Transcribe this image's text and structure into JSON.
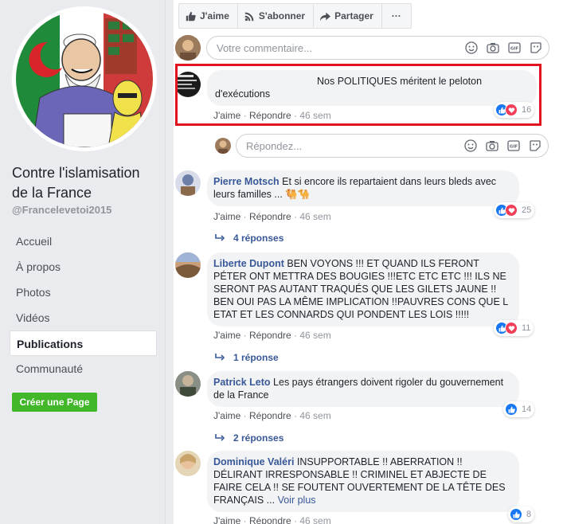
{
  "sidebar": {
    "page_name": "Contre l'islamisation de la France",
    "handle": "@Francelevetoi2015",
    "nav": [
      "Accueil",
      "À propos",
      "Photos",
      "Vidéos",
      "Publications",
      "Communauté"
    ],
    "active_nav": "Publications",
    "create_page": "Créer une Page"
  },
  "actions": {
    "like": "J'aime",
    "follow": "S'abonner",
    "share": "Partager",
    "more": "···"
  },
  "comment_input": {
    "placeholder": "Votre commentaire..."
  },
  "reply_input": {
    "placeholder": "Répondez..."
  },
  "comments": [
    {
      "author": "",
      "text": "Nos POLITIQUES méritent le peloton d'exécutions",
      "like": "J'aime",
      "reply": "Répondre",
      "time": "46 sem",
      "reactions": "16"
    },
    {
      "author": "Pierre Motsch",
      "text": "Et si encore ils repartaient dans leurs bleds avec leurs familles ... 🐫🐪",
      "like": "J'aime",
      "reply": "Répondre",
      "time": "46 sem",
      "reactions": "25",
      "replies": "4 réponses"
    },
    {
      "author": "Liberte Dupont",
      "text": "BEN VOYONS !!! ET QUAND ILS FERONT PÉTER ONT METTRA DES BOUGIES !!!ETC ETC ETC !!! ILS NE SERONT PAS AUTANT TRAQUÉS QUE LES GILETS JAUNE !! BEN OUI PAS LA MÊME IMPLICATION !!PAUVRES CONS QUE L ETAT ET LES CONNARDS QUI PONDENT LES LOIS !!!!!",
      "like": "J'aime",
      "reply": "Répondre",
      "time": "46 sem",
      "reactions": "11",
      "replies": "1 réponse"
    },
    {
      "author": "Patrick Leto",
      "text": "Les pays étrangers doivent rigoler du gouvernement de la France",
      "like": "J'aime",
      "reply": "Répondre",
      "time": "46 sem",
      "reactions": "14",
      "replies": "2 réponses"
    },
    {
      "author": "Dominique Valéri",
      "text": "INSUPPORTABLE !! ABERRATION !! DÉLIRANT IRRESPONSABLE !! CRIMINEL ET ABJECTE DE FAIRE CELA !! SE FOUTENT OUVERTEMENT DE LA TÊTE DES FRANÇAIS ...",
      "see_more": "Voir plus",
      "like": "J'aime",
      "reply": "Répondre",
      "time": "46 sem",
      "reactions": "8"
    }
  ],
  "colors": {
    "link": "#385898",
    "like_blue": "#1877f2",
    "love_red": "#f33e58",
    "highlight": "#e0131e",
    "create_green": "#42b72a"
  }
}
